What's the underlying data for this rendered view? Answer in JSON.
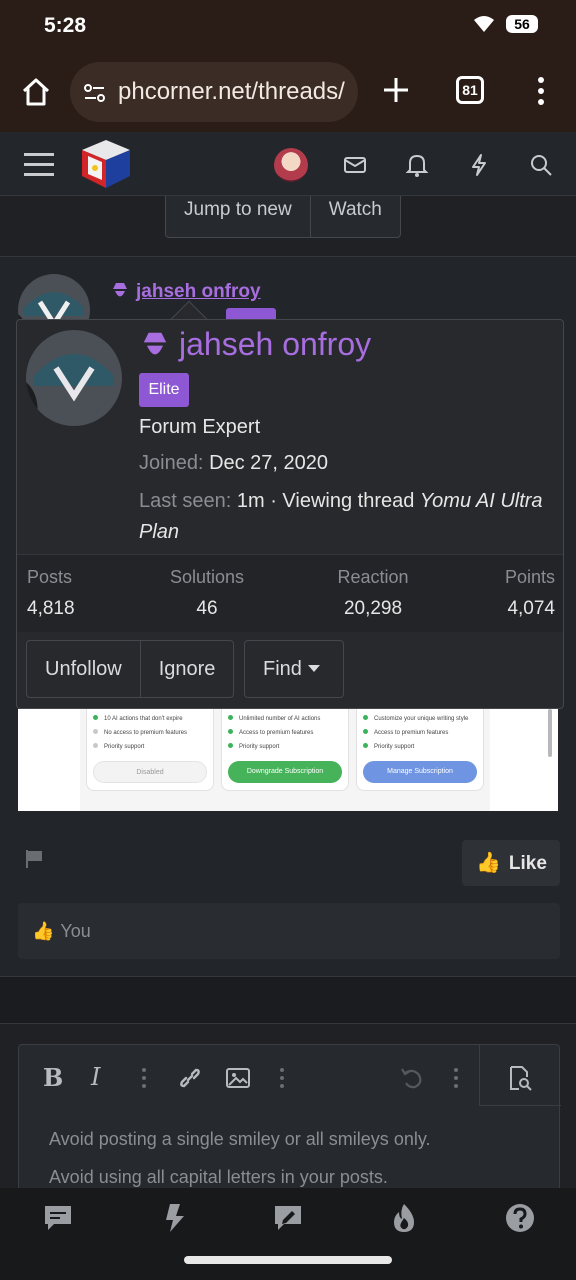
{
  "status_bar": {
    "time": "5:28",
    "battery": "56"
  },
  "browser": {
    "url": "phcorner.net/threads/",
    "tab_count": "81"
  },
  "thread_nav": {
    "jump_label": "Jump to new",
    "watch_label": "Watch"
  },
  "post": {
    "username": "jahseh onfroy"
  },
  "profile_card": {
    "name": "jahseh onfroy",
    "badge": "Elite",
    "title": "Forum Expert",
    "joined_label": "Joined:",
    "joined_value": "Dec 27, 2020",
    "last_seen_label": "Last seen:",
    "last_seen_value": "1m · Viewing thread",
    "last_seen_thread": "Yomu AI Ultra Plan",
    "stats": [
      {
        "label": "Posts",
        "value": "4,818"
      },
      {
        "label": "Solutions",
        "value": "46"
      },
      {
        "label": "Reaction",
        "value": "20,298"
      },
      {
        "label": "Points",
        "value": "4,074"
      }
    ],
    "actions": {
      "unfollow": "Unfollow",
      "ignore": "Ignore",
      "find": "Find"
    }
  },
  "embed": {
    "plans": [
      {
        "features": [
          "10 AI actions that don't expire",
          "No access to premium features",
          "Priority support"
        ],
        "button": "Disabled"
      },
      {
        "features": [
          "Unlimited number of AI actions",
          "Access to premium features",
          "Priority support"
        ],
        "button": "Downgrade Subscription"
      },
      {
        "features": [
          "Customize your unique writing style",
          "Access to premium features",
          "Priority support"
        ],
        "button": "Manage Subscription"
      }
    ],
    "colors": {
      "check": "#3bb35a",
      "muted_dot": "#c8c8cc",
      "downgrade": "#46b35a",
      "manage": "#6f95e2"
    }
  },
  "reactions": {
    "like_label": "Like",
    "thumb": "👍",
    "reacted_by": "You"
  },
  "editor": {
    "hints": [
      "Avoid posting a single smiley or all smileys only.",
      "Avoid using all capital letters in your posts."
    ],
    "toolbar": [
      "bold-icon",
      "italic-icon",
      "more-icon",
      "link-icon",
      "image-icon",
      "more-icon",
      "undo-icon",
      "more-icon",
      "preview-icon"
    ]
  },
  "bottom_nav": [
    "chat-icon",
    "lightning-icon",
    "compose-icon",
    "fire-icon",
    "help-icon"
  ],
  "theme": {
    "accent_purple": "#a86ee0",
    "badge_purple": "#8e58d4",
    "background": "#1f2124",
    "card": "#27292d"
  }
}
